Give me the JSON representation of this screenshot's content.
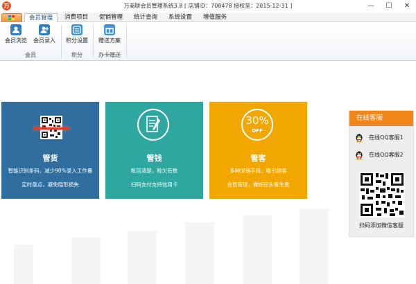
{
  "window": {
    "title": "万商联会员管理系统3.8  [ 店铺ID：708478 授权至：2015-12-31 ]",
    "controls": {
      "minimize": "—",
      "maximize": "☐",
      "close": "✕"
    }
  },
  "menu": {
    "tabs": [
      {
        "label": "会员管理",
        "active": true
      },
      {
        "label": "消费项目"
      },
      {
        "label": "促销管理"
      },
      {
        "label": "统计查询"
      },
      {
        "label": "系统设置"
      },
      {
        "label": "增值服务"
      }
    ]
  },
  "ribbon": {
    "buttons": [
      {
        "label": "会员浏览",
        "icon": "members-browse-icon"
      },
      {
        "label": "会员录入",
        "icon": "member-add-icon"
      },
      {
        "label": "积分设置",
        "icon": "points-settings-icon"
      },
      {
        "label": "赠送方案",
        "icon": "gift-plan-icon"
      }
    ],
    "groups": [
      {
        "label": "会员"
      },
      {
        "label": "积分"
      },
      {
        "label": "办卡赠送"
      }
    ]
  },
  "colors": {
    "card_goods": "#2f6e9e",
    "card_money": "#2ea7a0",
    "card_customer": "#f2a600",
    "service_header": "#f08519"
  },
  "cards": [
    {
      "title": "管货",
      "line1": "智能识别条码，减少90%录入工作量",
      "line2": "定时盘点，避免隐形损失",
      "icon": "barcode-scan-icon"
    },
    {
      "title": "管钱",
      "line1": "账目清楚，赊欠有数",
      "line2": "扫码支付支持信用卡",
      "icon": "ledger-pen-icon"
    },
    {
      "title": "管客",
      "line1": "多种促销手段，吸引顾客",
      "line2": "会员管理，做好回头客生意",
      "icon": "discount-badge-icon",
      "badge_number": "30%",
      "badge_text": "OFF"
    }
  ],
  "service": {
    "header": "在线客服",
    "qq1": "在线QQ客服1",
    "qq2": "在线QQ客服2",
    "wechat_caption": "扫码添加微信客服"
  }
}
